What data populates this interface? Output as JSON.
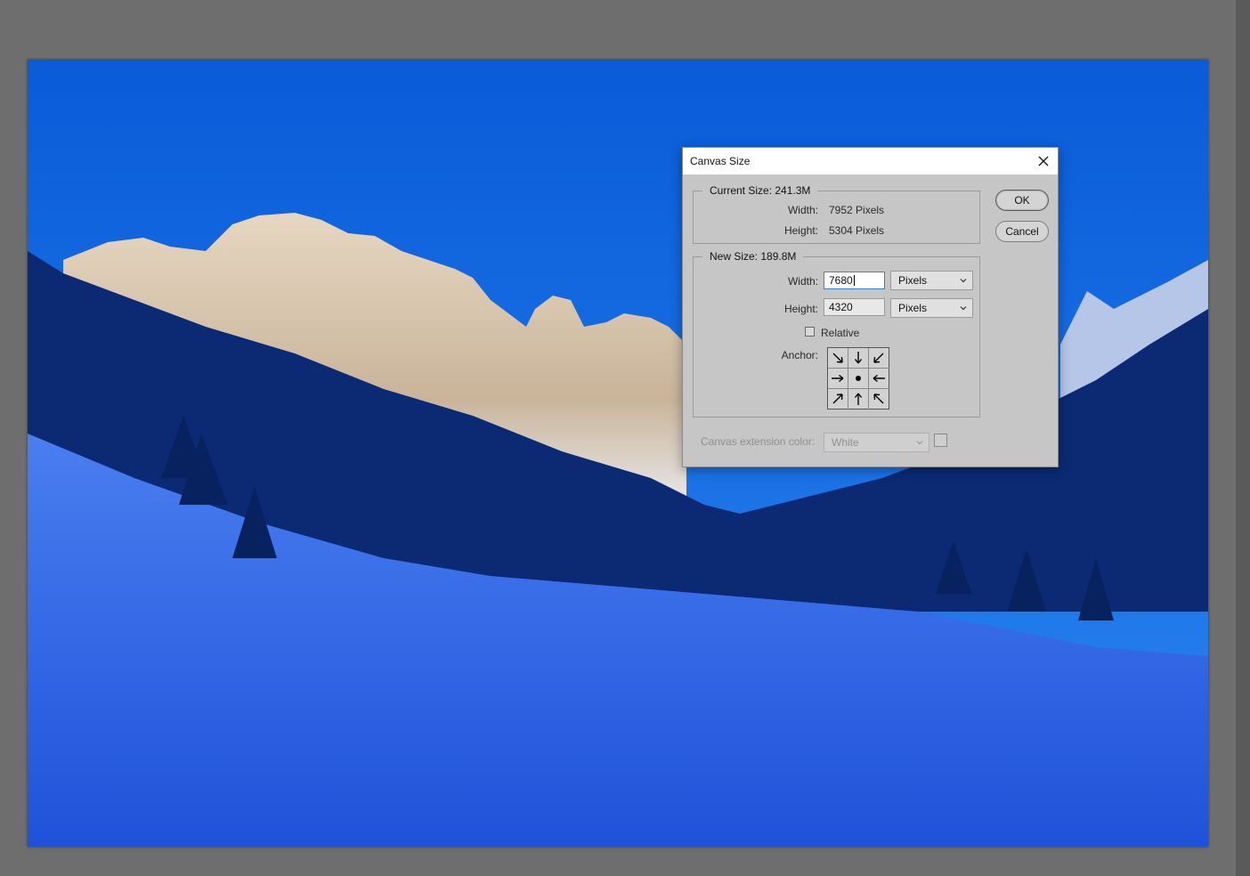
{
  "dialog": {
    "title": "Canvas Size",
    "current_size": {
      "label": "Current Size: 241.3M",
      "width_label": "Width:",
      "width_value": "7952 Pixels",
      "height_label": "Height:",
      "height_value": "5304 Pixels"
    },
    "new_size": {
      "label": "New Size: 189.8M",
      "width_label": "Width:",
      "width_value": "7680",
      "width_unit": "Pixels",
      "height_label": "Height:",
      "height_value": "4320",
      "height_unit": "Pixels",
      "relative_label": "Relative",
      "relative_checked": false,
      "anchor_label": "Anchor:",
      "anchor_selected": "center"
    },
    "extension": {
      "label": "Canvas extension color:",
      "value": "White"
    },
    "buttons": {
      "ok": "OK",
      "cancel": "Cancel"
    }
  },
  "colors": {
    "workspace": "#6e6e6e",
    "dialog_bg": "#c6c6c6",
    "focus": "#3c7fd5",
    "sky": "#1a6fe6"
  },
  "icons": {
    "close": "close-icon",
    "dropdown": "chevron-down-icon",
    "anchor_arrows": "arrow-icon"
  }
}
